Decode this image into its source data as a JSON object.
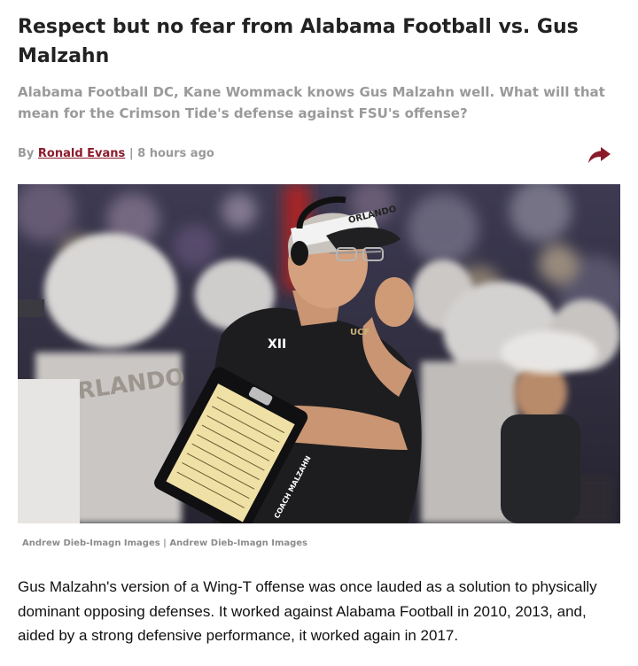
{
  "article": {
    "title": "Respect but no fear from Alabama Football vs. Gus Malzahn",
    "subtitle": "Alabama Football DC, Kane Wommack knows Gus Malzahn well. What will that mean for the Crimson Tide's defense against FSU's offense?",
    "byline": {
      "prefix": "By ",
      "author": "Ronald Evans",
      "separator": " | ",
      "timestamp": "8 hours ago"
    },
    "share_icon": "share-arrow-icon",
    "accent_color": "#8b1a2b",
    "photo": {
      "visor_text": "ORLANDO",
      "shirt_logo": "XII",
      "shirt_badge": "UCF",
      "clipboard_label": "COACH MALZAHN",
      "jersey_text": "ORLANDO"
    },
    "caption": "Andrew Dieb-Imagn Images | Andrew Dieb-Imagn Images",
    "body": "Gus Malzahn's version of a Wing-T offense was once lauded as a solution to physically dominant opposing defenses. It worked against Alabama Football in 2010, 2013, and, aided by a strong defensive performance, it worked again in 2017."
  }
}
